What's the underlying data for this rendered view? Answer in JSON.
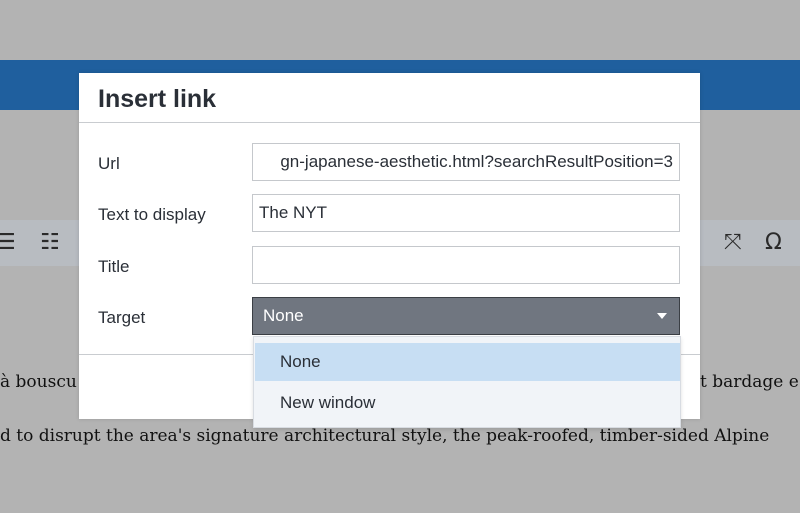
{
  "dialog": {
    "title": "Insert link",
    "fields": {
      "url": {
        "label": "Url",
        "value": "gn-japanese-aesthetic.html?searchResultPosition=3"
      },
      "text": {
        "label": "Text to display",
        "value": "The NYT"
      },
      "title": {
        "label": "Title",
        "value": ""
      },
      "target": {
        "label": "Target",
        "selected": "None"
      }
    },
    "target_options": [
      "None",
      "New window"
    ]
  },
  "background": {
    "line1_left": "à bouscu",
    "line1_right": "t bardage e",
    "line2": "d to disrupt the area's signature architectural style, the peak-roofed, timber-sided Alpine",
    "toolbar_icons": [
      "bullet-list-icon",
      "numbered-list-icon",
      "fullscreen-icon",
      "omega-icon"
    ]
  },
  "colors": {
    "overlay_gray": "#b3b3b3",
    "header_blue": "#1f5f9e",
    "select_bg": "#707680",
    "option_highlight": "#c7def3"
  }
}
